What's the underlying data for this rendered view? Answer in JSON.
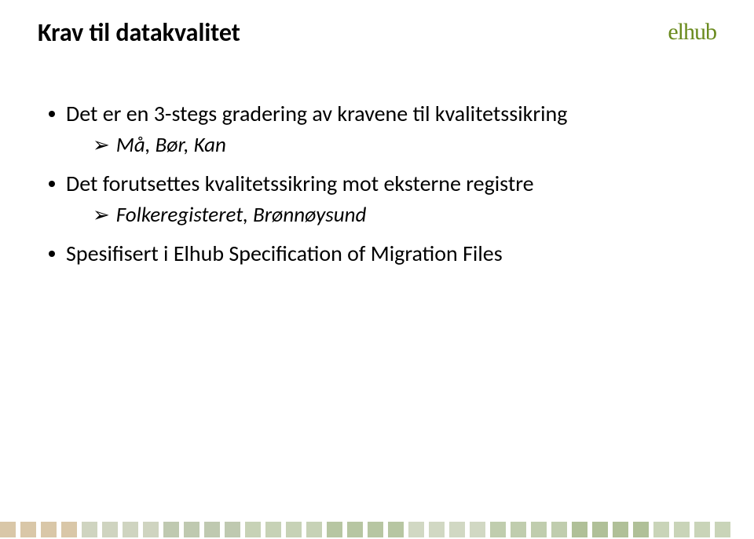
{
  "title": "Krav til datakvalitet",
  "logo": "elhub",
  "bullets": [
    {
      "level": 1,
      "text": "Det er en 3-stegs gradering av kravene til kvalitetssikring"
    },
    {
      "level": 2,
      "text": "Må, Bør, Kan"
    },
    {
      "level": 1,
      "text": "Det forutsettes kvalitetssikring mot eksterne registre"
    },
    {
      "level": 2,
      "text": "Folkeregisteret, Brønnøysund"
    },
    {
      "level": 1,
      "text": "Spesifisert i Elhub Specification of Migration Files"
    }
  ],
  "squares": [
    "#d9c7a8",
    "#d9c7a8",
    "#d9c7a8",
    "#d9c7a8",
    "#cfd4c0",
    "#cfd4c0",
    "#cfd4c0",
    "#cfd4c0",
    "#bfc9b0",
    "#bfc9b0",
    "#bfc9b0",
    "#bfc9b0",
    "#c7d2b6",
    "#c7d2b6",
    "#c7d2b6",
    "#c7d2b6",
    "#b7c6a2",
    "#b7c6a2",
    "#b7c6a2",
    "#b7c6a2",
    "#d1d8c3",
    "#d1d8c3",
    "#d1d8c3",
    "#d1d8c3",
    "#c0cdae",
    "#c0cdae",
    "#c0cdae",
    "#c0cdae",
    "#b0c098",
    "#b0c098",
    "#b0c098",
    "#b0c098",
    "#c9d4b8",
    "#c9d4b8",
    "#c9d4b8",
    "#c9d4b8"
  ]
}
